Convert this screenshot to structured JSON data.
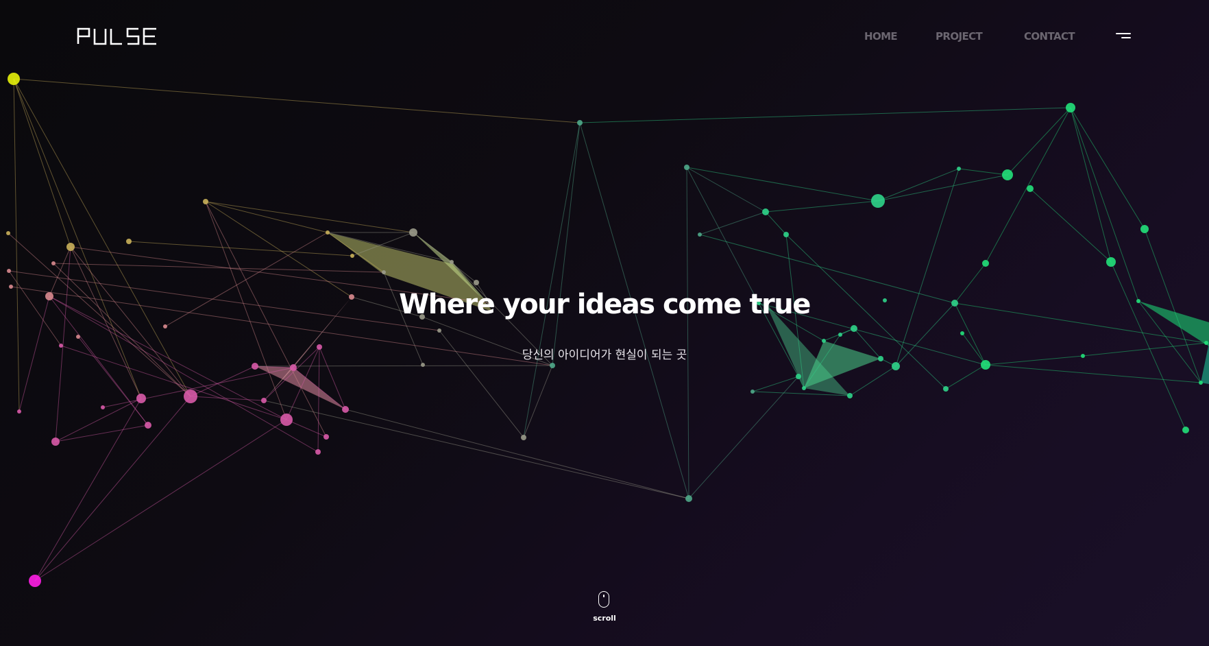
{
  "brand": {
    "logo_text": "PULSE"
  },
  "nav": {
    "items": [
      {
        "label": "HOME",
        "active": true
      },
      {
        "label": "PROJECT",
        "active": false
      },
      {
        "label": "CONTACT",
        "active": false
      }
    ],
    "menu_icon": "hamburger-menu-icon"
  },
  "hero": {
    "title": "Where your ideas come true",
    "subtitle": "당신의 아이디어가 현실이 되는 곳"
  },
  "scroll": {
    "label": "scroll",
    "icon": "mouse-icon"
  },
  "colors": {
    "background": "#0b0a0d",
    "background_accent": "#1a1028",
    "yellow": "#e6f20a",
    "pink": "#e0679a",
    "magenta": "#ff1ee6",
    "green": "#22e650",
    "teal": "#1ed2a0",
    "text": "#ffffff",
    "nav_inactive": "#6b6670"
  }
}
